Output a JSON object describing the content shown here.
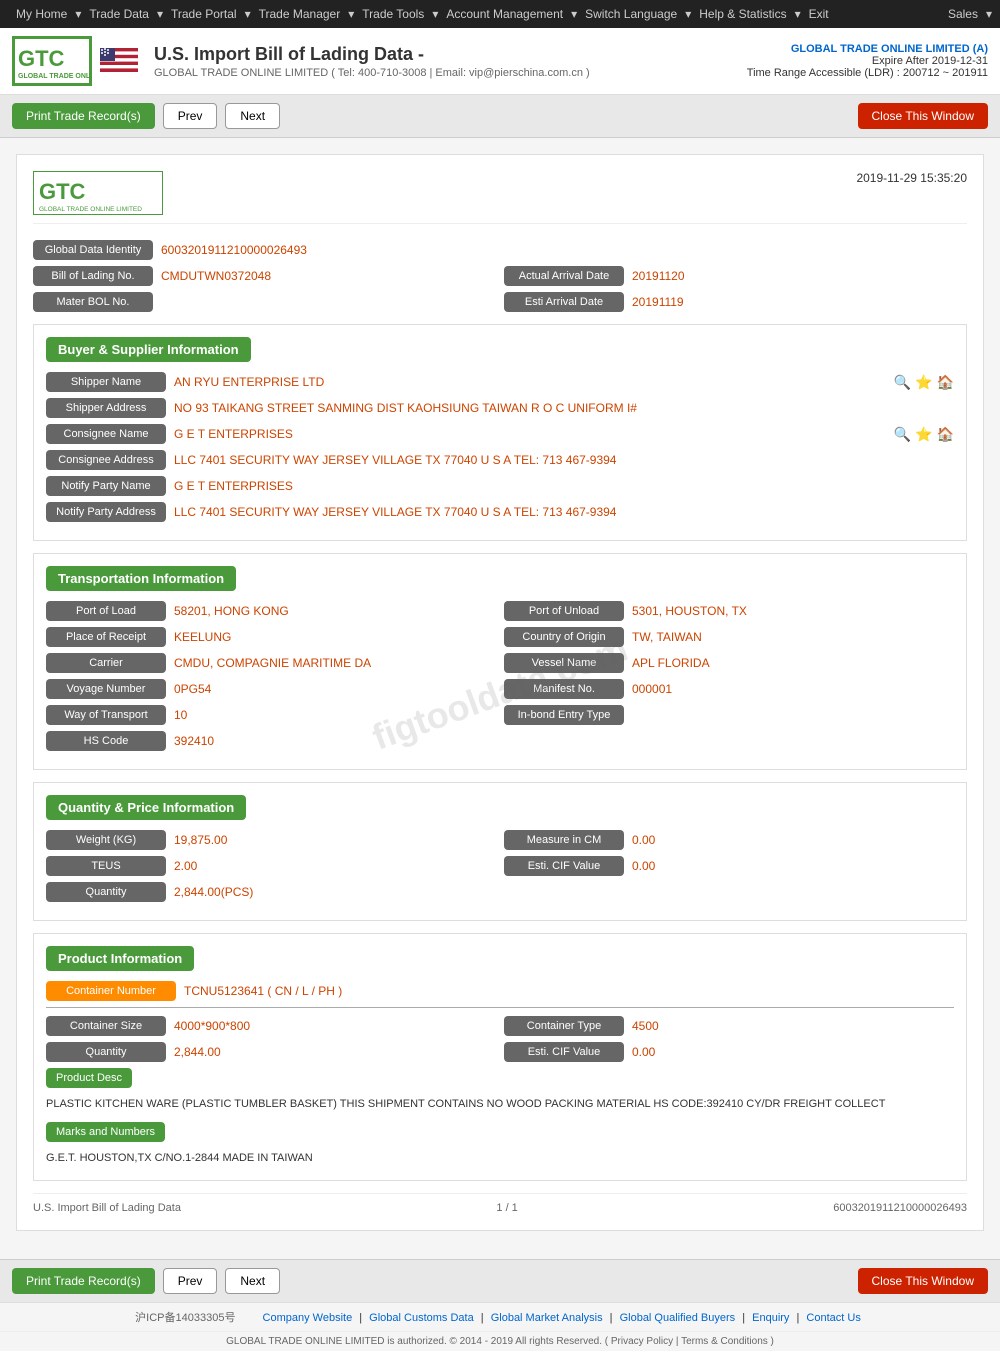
{
  "nav": {
    "items": [
      {
        "label": "My Home",
        "has_arrow": true
      },
      {
        "label": "Trade Data",
        "has_arrow": true
      },
      {
        "label": "Trade Portal",
        "has_arrow": true
      },
      {
        "label": "Trade Manager",
        "has_arrow": true
      },
      {
        "label": "Trade Tools",
        "has_arrow": true
      },
      {
        "label": "Account Management",
        "has_arrow": true
      },
      {
        "label": "Switch Language",
        "has_arrow": true
      },
      {
        "label": "Help & Statistics",
        "has_arrow": true
      },
      {
        "label": "Exit",
        "has_arrow": false
      }
    ],
    "sales_label": "Sales"
  },
  "header": {
    "logo_text": "GTC",
    "logo_sub": "GLOBAL TRADE ONLINE LIMITED",
    "title": "U.S. Import Bill of Lading Data",
    "title_suffix": "-",
    "company_info": "GLOBAL TRADE ONLINE LIMITED ( Tel: 400-710-3008 | Email: vip@pierschina.com.cn )",
    "account_name": "GLOBAL TRADE ONLINE LIMITED (A)",
    "expire": "Expire After 2019-12-31",
    "ldr": "Time Range Accessible (LDR) : 200712 ~ 201911"
  },
  "toolbar": {
    "print_label": "Print Trade Record(s)",
    "prev_label": "Prev",
    "next_label": "Next",
    "close_label": "Close This Window"
  },
  "document": {
    "logo_text": "GTC",
    "logo_sub": "GLOBAL TRADE ONLINE LIMITED",
    "timestamp": "2019-11-29 15:35:20",
    "global_data_identity_label": "Global Data Identity",
    "global_data_identity_value": "6003201911210000026493",
    "bill_of_lading_label": "Bill of Lading No.",
    "bill_of_lading_value": "CMDUTWN0372048",
    "actual_arrival_label": "Actual Arrival Date",
    "actual_arrival_value": "20191120",
    "master_bol_label": "Mater BOL No.",
    "master_bol_value": "",
    "esti_arrival_label": "Esti Arrival Date",
    "esti_arrival_value": "20191119"
  },
  "buyer_supplier": {
    "section_label": "Buyer & Supplier Information",
    "shipper_name_label": "Shipper Name",
    "shipper_name_value": "AN RYU ENTERPRISE LTD",
    "shipper_address_label": "Shipper Address",
    "shipper_address_value": "NO 93 TAIKANG STREET SANMING DIST KAOHSIUNG TAIWAN R O C UNIFORM I#",
    "consignee_name_label": "Consignee Name",
    "consignee_name_value": "G E T ENTERPRISES",
    "consignee_address_label": "Consignee Address",
    "consignee_address_value": "LLC 7401 SECURITY WAY JERSEY VILLAGE TX 77040 U S A TEL: 713 467-9394",
    "notify_party_name_label": "Notify Party Name",
    "notify_party_name_value": "G E T ENTERPRISES",
    "notify_party_address_label": "Notify Party Address",
    "notify_party_address_value": "LLC 7401 SECURITY WAY JERSEY VILLAGE TX 77040 U S A TEL: 713 467-9394"
  },
  "transportation": {
    "section_label": "Transportation Information",
    "port_of_load_label": "Port of Load",
    "port_of_load_value": "58201, HONG KONG",
    "port_of_unload_label": "Port of Unload",
    "port_of_unload_value": "5301, HOUSTON, TX",
    "place_of_receipt_label": "Place of Receipt",
    "place_of_receipt_value": "KEELUNG",
    "country_of_origin_label": "Country of Origin",
    "country_of_origin_value": "TW, TAIWAN",
    "carrier_label": "Carrier",
    "carrier_value": "CMDU, COMPAGNIE MARITIME DA",
    "vessel_name_label": "Vessel Name",
    "vessel_name_value": "APL FLORIDA",
    "voyage_number_label": "Voyage Number",
    "voyage_number_value": "0PG54",
    "manifest_no_label": "Manifest No.",
    "manifest_no_value": "000001",
    "way_of_transport_label": "Way of Transport",
    "way_of_transport_value": "10",
    "inbond_entry_label": "In-bond Entry Type",
    "inbond_entry_value": "",
    "hs_code_label": "HS Code",
    "hs_code_value": "392410"
  },
  "quantity_price": {
    "section_label": "Quantity & Price Information",
    "weight_label": "Weight (KG)",
    "weight_value": "19,875.00",
    "measure_label": "Measure in CM",
    "measure_value": "0.00",
    "teus_label": "TEUS",
    "teus_value": "2.00",
    "esti_cif_label": "Esti. CIF Value",
    "esti_cif_value": "0.00",
    "quantity_label": "Quantity",
    "quantity_value": "2,844.00(PCS)"
  },
  "product_info": {
    "section_label": "Product Information",
    "container_number_label": "Container Number",
    "container_number_value": "TCNU5123641 ( CN / L / PH )",
    "container_size_label": "Container Size",
    "container_size_value": "4000*900*800",
    "container_type_label": "Container Type",
    "container_type_value": "4500",
    "quantity_label": "Quantity",
    "quantity_value": "2,844.00",
    "esti_cif_label": "Esti. CIF Value",
    "esti_cif_value": "0.00",
    "product_desc_label": "Product Desc",
    "product_desc_value": "PLASTIC KITCHEN WARE (PLASTIC TUMBLER BASKET) THIS SHIPMENT CONTAINS NO WOOD PACKING MATERIAL HS CODE:392410 CY/DR FREIGHT COLLECT",
    "marks_label": "Marks and Numbers",
    "marks_value": "G.E.T. HOUSTON,TX C/NO.1-2844 MADE IN TAIWAN"
  },
  "doc_footer": {
    "left_label": "U.S. Import Bill of Lading Data",
    "page_info": "1 / 1",
    "right_value": "6003201911210000026493"
  },
  "footer": {
    "icp": "沪ICP备14033305号",
    "links": [
      "Company Website",
      "Global Customs Data",
      "Global Market Analysis",
      "Global Qualified Buyers",
      "Enquiry",
      "Contact Us"
    ],
    "copyright": "GLOBAL TRADE ONLINE LIMITED is authorized. © 2014 - 2019 All rights Reserved.  (  Privacy Policy  |  Terms & Conditions  )"
  },
  "watermark": "figtooldata.com"
}
